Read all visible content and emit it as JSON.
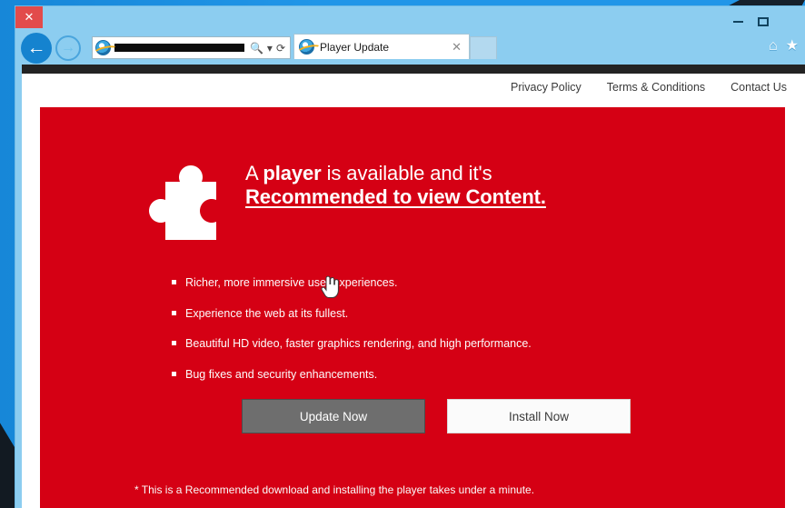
{
  "window": {
    "title": "Player Update",
    "controls": {
      "minimize": "–",
      "maximize": "▢",
      "close": "✕"
    }
  },
  "browser": {
    "back_label": "←",
    "forward_label": "→",
    "address": {
      "value": "",
      "redacted": true,
      "search_icon": "🔍",
      "dropdown_icon": "▾",
      "refresh_icon": "⟳"
    },
    "tabs": [
      {
        "label": "Player Update",
        "close_label": "✕",
        "active": true
      }
    ],
    "new_tab_label": "",
    "toolbar_icons": [
      {
        "name": "home-icon",
        "glyph": "⌂"
      },
      {
        "name": "favorites-star-icon",
        "glyph": "★"
      }
    ]
  },
  "site": {
    "nav_links": [
      "Privacy Policy",
      "Terms & Conditions",
      "Contact Us"
    ],
    "hero": {
      "headline_line1_prefix": "A ",
      "headline_line1_bold": "player",
      "headline_line1_suffix": " is available and it's",
      "headline_line2": "Recommended to view Content.",
      "bullets": [
        "Richer, more immersive user experiences.",
        "Experience the web at its fullest.",
        "Beautiful HD video, faster graphics rendering, and high performance.",
        "Bug fixes and security enhancements."
      ],
      "primary_button": "Update Now",
      "secondary_button": "Install Now",
      "footnote": "* This is a Recommended download and installing the player takes under a minute."
    }
  },
  "colors": {
    "hero_red": "#d50014",
    "topbar_dark": "#232323",
    "update_button_gray": "#6e6e6e",
    "install_button_white": "#fbfbfb",
    "browser_chrome_blue": "#8ccdf0",
    "close_button_red": "#e24b4b",
    "desktop_blue": "#2196e8"
  }
}
